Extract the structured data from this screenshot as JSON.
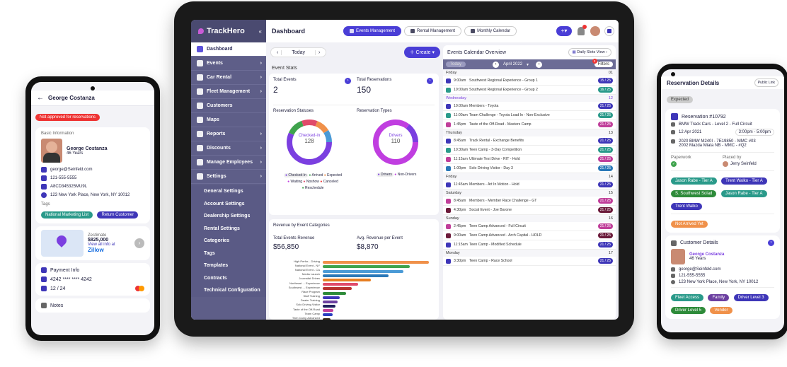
{
  "left_phone": {
    "name": "George Costanza",
    "alert": "Not approved for reservations",
    "basic_info_label": "Basic Information",
    "person_name": "George Costanza",
    "age": "46 Years",
    "email": "george@Seinfeld.com",
    "phone": "121-555-5555",
    "license": "A8CD345325MU9L",
    "address": "123 New York Place, New York, NY 10012",
    "tags_label": "Tags",
    "tags": [
      "National Marketing List",
      "Return Customer"
    ],
    "zestimate_label": "Zestimate",
    "zestimate_value": "$825,000",
    "zillow_link": "View all info at",
    "zillow": "Zillow",
    "payment_label": "Payment Info",
    "card_number": "4242 **** **** 4242",
    "card_exp": "12 / 24",
    "notes_label": "Notes"
  },
  "app": {
    "brand": "TrackHero",
    "page_title": "Dashboard"
  },
  "top_tabs": [
    "Events Management",
    "Rental Management",
    "Monthly Calendar"
  ],
  "sidebar": {
    "items": [
      {
        "label": "Dashboard",
        "arrow": ""
      },
      {
        "label": "Events",
        "arrow": "›"
      },
      {
        "label": "Car Rental",
        "arrow": "›"
      },
      {
        "label": "Fleet Management",
        "arrow": "›"
      },
      {
        "label": "Customers",
        "arrow": ""
      },
      {
        "label": "Maps",
        "arrow": ""
      },
      {
        "label": "Reports",
        "arrow": "›"
      },
      {
        "label": "Discounts",
        "arrow": "›"
      },
      {
        "label": "Manage Employees",
        "arrow": "›"
      },
      {
        "label": "Settings",
        "arrow": "›"
      }
    ],
    "sub": [
      "General Settings",
      "Account Settings",
      "Dealership Settings",
      "Rental Settings",
      "Categories",
      "Tags",
      "Templates",
      "Contracts",
      "Technical Configuration"
    ]
  },
  "toolbar": {
    "today": "Today",
    "create": "Create"
  },
  "stats": {
    "title": "Event Stats",
    "total_events_label": "Total Events",
    "total_events": "2",
    "total_res_label": "Total Reservations",
    "total_res": "150",
    "statuses_label": "Reservation Statuses",
    "donut1_label": "Checked-in",
    "donut1_value": "128",
    "types_label": "Reservation Types",
    "donut2_label": "Drivers",
    "donut2_value": "110",
    "legend1": [
      "Checked-In",
      "Arrived",
      "Expected",
      "Waiting",
      "Noshow",
      "Canceled",
      "Reschedule"
    ],
    "legend2": [
      "Drivers",
      "Non-Drivers"
    ]
  },
  "revenue": {
    "title": "Revenue by Event Categories",
    "total_label": "Total Events Revenue",
    "total": "$56,850",
    "avg_label": "Avg. Revenue per Event",
    "avg": "$8,870"
  },
  "chart_data": {
    "type": "bar",
    "categories": [
      "High Perfor... Driving",
      "National Event - NY",
      "National Event - CA",
      "Media Launch",
      "Journalist Drives",
      "Northeast ... Experience",
      "Southwest ... Experience",
      "Race Program",
      "Staff Training",
      "Dealer Training",
      "Solo Driving Visitor",
      "Taste of the Off-Road",
      "Team Camp",
      "Teen Camp Advanced"
    ],
    "values": [
      100,
      82,
      76,
      62,
      45,
      33,
      27,
      22,
      16,
      14,
      12,
      10,
      9,
      7
    ],
    "colors": [
      "#f0914a",
      "#3fa34d",
      "#4a9ad6",
      "#2a78b8",
      "#e67e22",
      "#e04a6a",
      "#b8322e",
      "#2e8b3a",
      "#3e36b8",
      "#6b3fa0",
      "#1e1e5c",
      "#c03e9a",
      "#2a3ec0",
      "#3a2a1a"
    ]
  },
  "calendar": {
    "title": "Events Calendar Overview",
    "view": "Daily Slots View",
    "today": "Today",
    "month": "April 2022",
    "filters": "Filters",
    "filter_count": "2",
    "days": [
      {
        "name": "Friday",
        "num": "01",
        "events": [
          {
            "time": "9:00am",
            "name": "Southwest Regional Experience  -  Group 1",
            "count": "15 / 25",
            "color": "#3e36b8"
          },
          {
            "time": "10:00am",
            "name": "Southwest Regional Experience  -  Group 2",
            "count": "16 / 25",
            "color": "#2a9a8a"
          }
        ]
      },
      {
        "name": "Wednesday",
        "num": "12",
        "events": [
          {
            "time": "10:00am",
            "name": "Members  -  Toyota",
            "count": "21 / 25",
            "color": "#3e36b8"
          },
          {
            "time": "11:00am",
            "name": "Team Challenge  -  Toyota Load In - Non-Exclusive",
            "count": "21 / 25",
            "color": "#2a9a8a"
          },
          {
            "time": "1:45pm",
            "name": "Taste of the Off-Road  -  Masters Camp",
            "count": "21 / 25",
            "color": "#c03e9a"
          }
        ]
      },
      {
        "name": "Thursday",
        "num": "13",
        "events": [
          {
            "time": "8:45am",
            "name": "Track Rental  -  Exchange Benefits",
            "count": "21 / 25",
            "color": "#3e36b8"
          },
          {
            "time": "10:30am",
            "name": "Teen Camp  -  3-Day Competition",
            "count": "21 / 25",
            "color": "#2a9a8a"
          },
          {
            "time": "11:15am",
            "name": "Ultimate Test Drive  -  RIT - Hold",
            "count": "21 / 25",
            "color": "#c03e9a"
          },
          {
            "time": "1:00pm",
            "name": "Solo Driving Visitor  -  Day 3",
            "count": "21 / 25",
            "color": "#2a78b8"
          }
        ]
      },
      {
        "name": "Friday",
        "num": "14",
        "events": [
          {
            "time": "11:45am",
            "name": "Members  -  Art In Motion - Hold",
            "count": "21 / 25",
            "color": "#3e36b8"
          }
        ]
      },
      {
        "name": "Saturday",
        "num": "15",
        "events": [
          {
            "time": "8:45am",
            "name": "Members  -  Member Race Challenge - GT",
            "count": "21 / 25",
            "color": "#c03e9a"
          },
          {
            "time": "4:30pm",
            "name": "Social Event  -  Joe Barone",
            "count": "21 / 25",
            "color": "#6b1a3a"
          }
        ]
      },
      {
        "name": "Sunday",
        "num": "16",
        "events": [
          {
            "time": "2:45pm",
            "name": "Teen Camp Advanced  -  Full Circuit",
            "count": "21 / 25",
            "color": "#c03e9a"
          },
          {
            "time": "9:00am",
            "name": "Teen Camp Advanced  -  Arch Capital - HOLD",
            "count": "21 / 25",
            "color": "#6b1a3a"
          },
          {
            "time": "11:15am",
            "name": "Teen Camp  -  Modified Schedule",
            "count": "21 / 25",
            "color": "#3e36b8"
          }
        ]
      },
      {
        "name": "Monday",
        "num": "17",
        "events": [
          {
            "time": "3:30pm",
            "name": "Teen Camp  -  Race School",
            "count": "21 / 25",
            "color": "#3e36b8"
          }
        ]
      }
    ]
  },
  "right_phone": {
    "title": "Reservation Details",
    "public_link": "Public Link",
    "status": "Expected",
    "reservation": "Reservation #10792",
    "track": "BMW Track Cars - Level 2 - Full Circuit",
    "date": "12 Apr 2021",
    "time": "3:00pm - 5:00pm",
    "car1": "2020 BMW M240I - 7E19850 - MMC #03",
    "car2": "2002 Mazda Miata NB - MMC - #Q2",
    "paperwork_label": "Paperwork",
    "placed_by_label": "Placed by",
    "placed_by": "Jerry Seinfeld",
    "chips": [
      "Jason Rabe - Tier A",
      "Trent Walko - Tier A",
      "S. Southwest Solad",
      "Jason Rabe - Tier A",
      "Trent Walko"
    ],
    "not_arrived": "Not Arrived Yet",
    "customer_label": "Customer Details",
    "customer_name": "George Costanza",
    "customer_age": "46 Years",
    "email": "george@Seinfeld.com",
    "phone": "121-555-5555",
    "address": "123 New York Place, New York, NY 10012",
    "tags": [
      "Fleet Access",
      "Family",
      "Driver Level 3",
      "Driver Level 5",
      "Vendor"
    ]
  }
}
